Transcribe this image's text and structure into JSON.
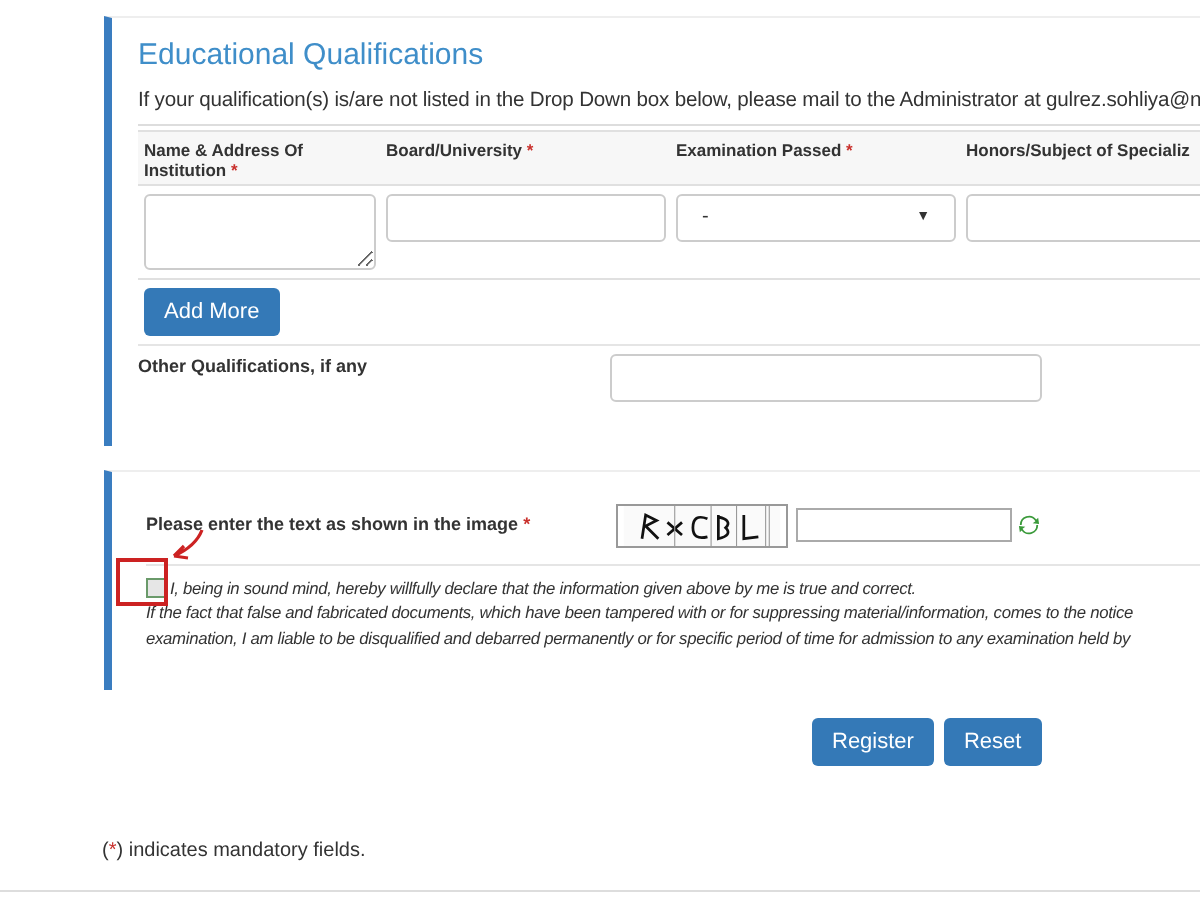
{
  "qualifications": {
    "title": "Educational Qualifications",
    "note": "If your qualification(s) is/are not listed in the Drop Down box below, please mail to the Administrator at gulrez.sohliya@n",
    "columns": [
      {
        "label": "Name & Address Of Institution",
        "mark": "*",
        "kind": "textarea"
      },
      {
        "label": "Board/University",
        "mark": "*",
        "kind": "text"
      },
      {
        "label": "Examination Passed",
        "mark": "*",
        "kind": "select",
        "value": "-",
        "arrow": "▼"
      },
      {
        "label": "Honors/Subject of Specializ",
        "kind": "text"
      }
    ],
    "add_button": "Add More",
    "other_label": "Other Qualifications, if any"
  },
  "verification": {
    "captcha_label": "Please enter the text as shown in the image",
    "captcha_mark": "*",
    "declaration_checked": false,
    "declaration": "I, being in sound mind, hereby willfully declare that the information given above by me is true and correct.",
    "declaration_note": [
      "If the fact that false and fabricated documents, which have been tampered with or for suppressing material/information, comes to the notice",
      "examination, I am liable to be disqualified and debarred permanently or for specific period of time for admission to any examination held by"
    ]
  },
  "buttons": [
    "Register",
    "Reset"
  ],
  "footer": {
    "before": "(",
    "mark": "*",
    "after": ") indicates mandatory fields."
  }
}
